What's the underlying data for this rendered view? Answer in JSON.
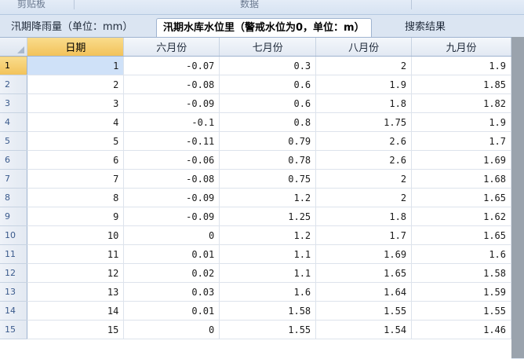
{
  "ribbon": {
    "group_clipboard": "剪贴板",
    "group_data": "数据"
  },
  "tabs": [
    {
      "label": "汛期降雨量（单位：mm）"
    },
    {
      "label": "汛期水库水位里（警戒水位为0，单位：m）"
    },
    {
      "label": "搜索结果"
    }
  ],
  "table": {
    "columns": [
      "日期",
      "六月份",
      "七月份",
      "八月份",
      "九月份"
    ],
    "rows": [
      {
        "num": "1",
        "cells": [
          "1",
          "-0.07",
          "0.3",
          "2",
          "1.9"
        ]
      },
      {
        "num": "2",
        "cells": [
          "2",
          "-0.08",
          "0.6",
          "1.9",
          "1.85"
        ]
      },
      {
        "num": "3",
        "cells": [
          "3",
          "-0.09",
          "0.6",
          "1.8",
          "1.82"
        ]
      },
      {
        "num": "4",
        "cells": [
          "4",
          "-0.1",
          "0.8",
          "1.75",
          "1.9"
        ]
      },
      {
        "num": "5",
        "cells": [
          "5",
          "-0.11",
          "0.79",
          "2.6",
          "1.7"
        ]
      },
      {
        "num": "6",
        "cells": [
          "6",
          "-0.06",
          "0.78",
          "2.6",
          "1.69"
        ]
      },
      {
        "num": "7",
        "cells": [
          "7",
          "-0.08",
          "0.75",
          "2",
          "1.68"
        ]
      },
      {
        "num": "8",
        "cells": [
          "8",
          "-0.09",
          "1.2",
          "2",
          "1.65"
        ]
      },
      {
        "num": "9",
        "cells": [
          "9",
          "-0.09",
          "1.25",
          "1.8",
          "1.62"
        ]
      },
      {
        "num": "10",
        "cells": [
          "10",
          "0",
          "1.2",
          "1.7",
          "1.65"
        ]
      },
      {
        "num": "11",
        "cells": [
          "11",
          "0.01",
          "1.1",
          "1.69",
          "1.6"
        ]
      },
      {
        "num": "12",
        "cells": [
          "12",
          "0.02",
          "1.1",
          "1.65",
          "1.58"
        ]
      },
      {
        "num": "13",
        "cells": [
          "13",
          "0.03",
          "1.6",
          "1.64",
          "1.59"
        ]
      },
      {
        "num": "14",
        "cells": [
          "14",
          "0.01",
          "1.58",
          "1.55",
          "1.55"
        ]
      },
      {
        "num": "15",
        "cells": [
          "15",
          "0",
          "1.55",
          "1.54",
          "1.46"
        ]
      }
    ]
  },
  "colors": {
    "selection_header": "#f2c25a",
    "selected_cell": "#cfe1f8",
    "sheet_background": "#ffffff"
  }
}
